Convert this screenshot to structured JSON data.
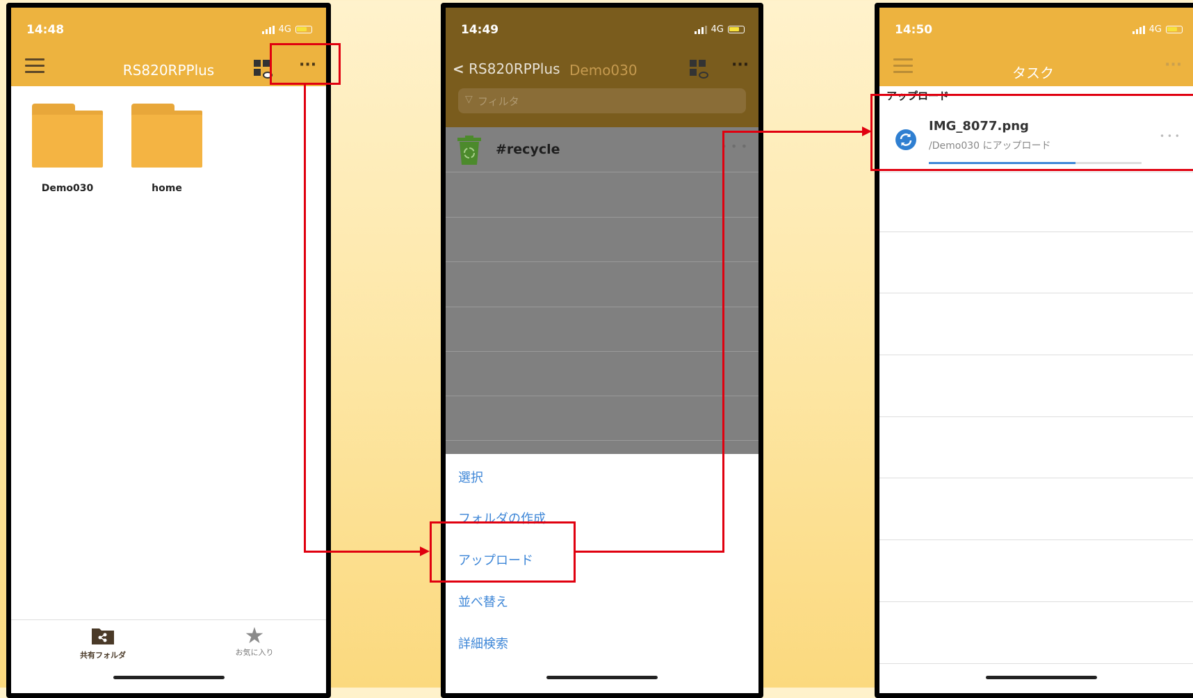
{
  "colors": {
    "accent": "#edb33f",
    "link": "#3d86d7",
    "highlight": "#e0000f"
  },
  "phone1": {
    "time": "14:48",
    "network": "4G",
    "title": "RS820RPPlus",
    "folders": [
      {
        "label": "Demo030",
        "icon": "folder-icon"
      },
      {
        "label": "home",
        "icon": "folder-icon"
      }
    ],
    "tabs": [
      {
        "label": "共有フォルダ",
        "icon": "shared-folder-icon"
      },
      {
        "label": "お気に入り",
        "icon": "star-icon"
      }
    ]
  },
  "phone2": {
    "time": "14:49",
    "network": "4G",
    "back_label": "RS820RPPlus",
    "title": "Demo030",
    "filter_placeholder": "フィルタ",
    "items": [
      {
        "label": "#recycle",
        "icon": "recycle-bin-icon"
      }
    ],
    "menu": [
      "選択",
      "フォルダの作成",
      "アップロード",
      "並べ替え",
      "詳細検索"
    ]
  },
  "phone3": {
    "time": "14:50",
    "network": "4G",
    "title": "タスク",
    "section": "アップロード",
    "task": {
      "filename": "IMG_8077.png",
      "subtitle": "/Demo030 にアップロード",
      "progress": 0.69,
      "icon": "sync-icon"
    }
  }
}
